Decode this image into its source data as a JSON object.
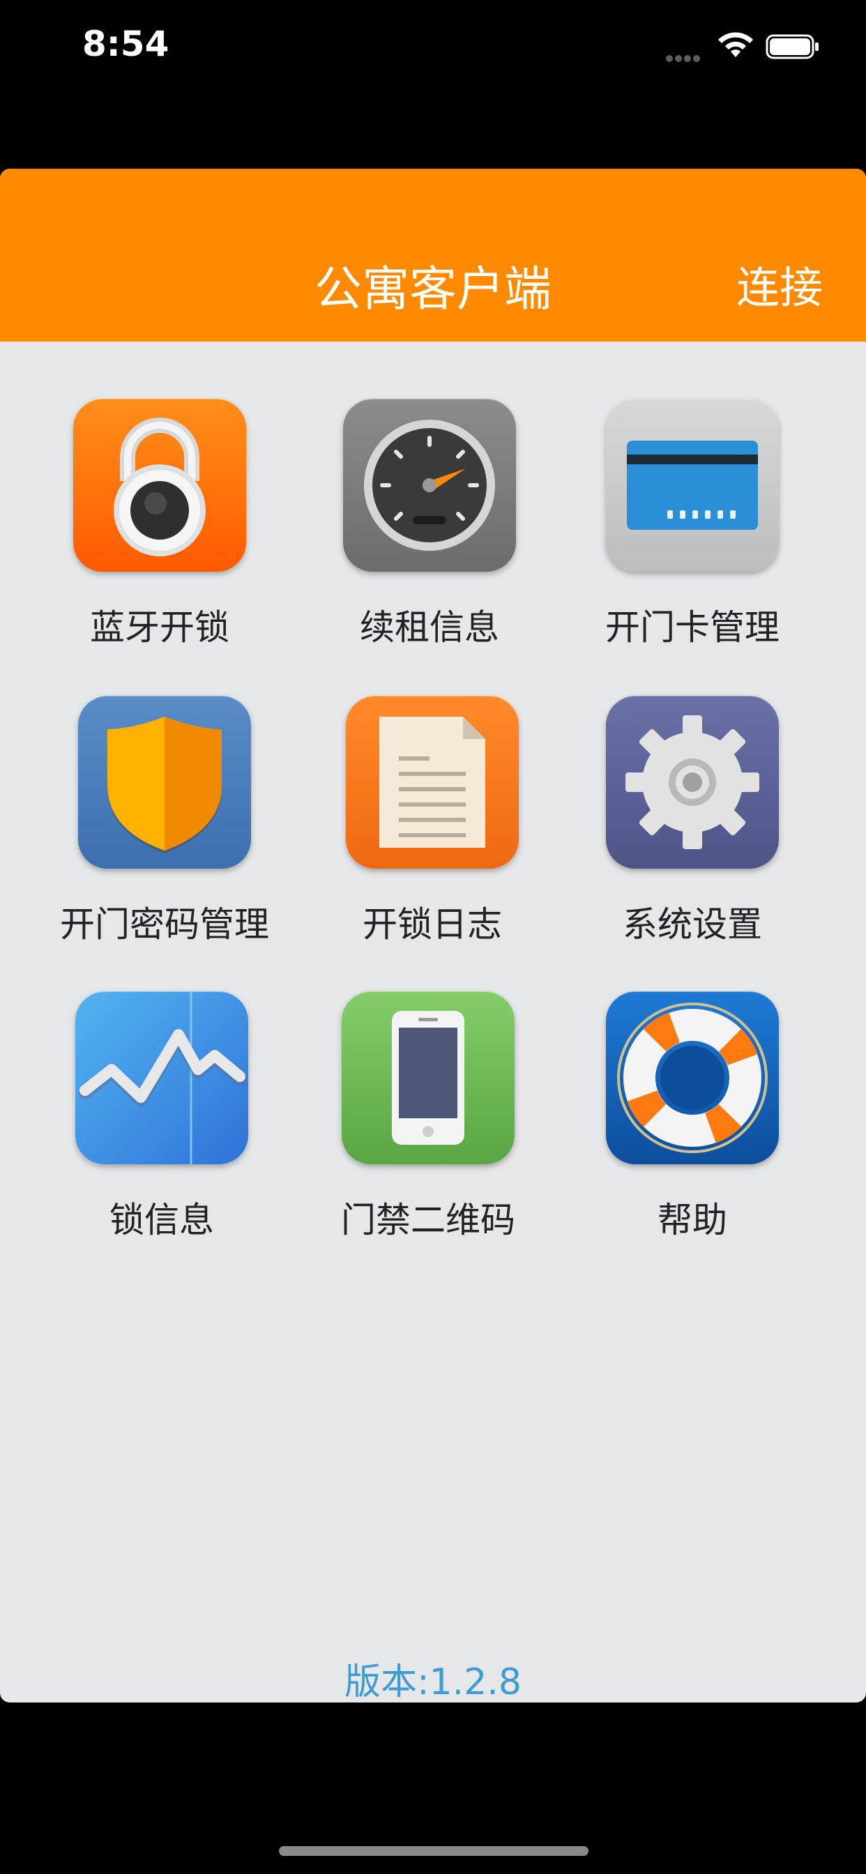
{
  "status_bar": {
    "time": "8:54"
  },
  "nav": {
    "title": "公寓客户端",
    "connect_label": "连接"
  },
  "menu": [
    {
      "label": "蓝牙开锁",
      "icon": "padlock-icon"
    },
    {
      "label": "续租信息",
      "icon": "speedometer-icon"
    },
    {
      "label": "开门卡管理",
      "icon": "card-icon"
    },
    {
      "label": "开门密码管理",
      "icon": "shield-icon"
    },
    {
      "label": "开锁日志",
      "icon": "document-icon"
    },
    {
      "label": "系统设置",
      "icon": "gear-icon"
    },
    {
      "label": "锁信息",
      "icon": "chart-icon"
    },
    {
      "label": "门禁二维码",
      "icon": "phone-icon"
    },
    {
      "label": "帮助",
      "icon": "lifebuoy-icon"
    }
  ],
  "footer": {
    "version": "版本:1.2.8"
  },
  "colors": {
    "nav_bg": "#ff8a00",
    "content_bg": "#e6e7e9",
    "version_text": "#3f9bd3"
  }
}
